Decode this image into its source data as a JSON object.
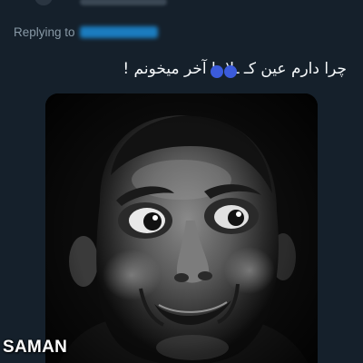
{
  "reply": {
    "prefix": "Replying to"
  },
  "tweet": {
    "text": "چرا دارم عین کـ  ـلا تا آخر میخونم !"
  },
  "media": {
    "description_icon": "meme-face-image"
  },
  "watermark": {
    "text": "SAMAN"
  },
  "colors": {
    "background": "#15202b",
    "muted_text": "#8899a6",
    "mention_blue": "#1d9bf0",
    "censor_blue": "#3b5bdb"
  }
}
